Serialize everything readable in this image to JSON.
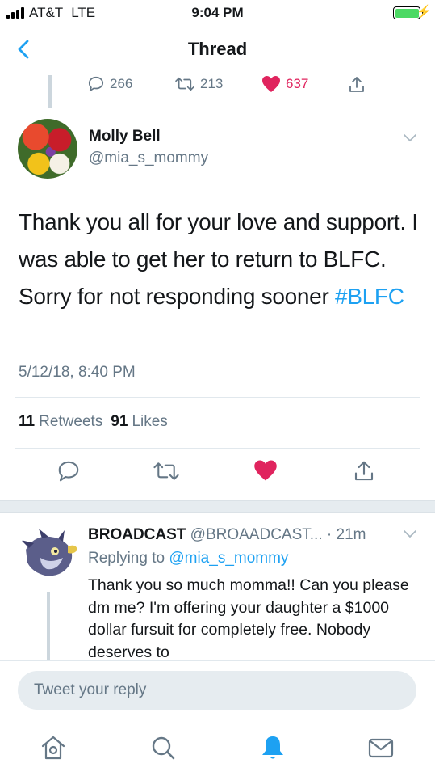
{
  "status_bar": {
    "carrier": "AT&T",
    "network": "LTE",
    "time": "9:04 PM",
    "battery_level": 1.0,
    "battery_color": "#4cd964"
  },
  "nav": {
    "title": "Thread",
    "back_icon": "chevron-left-icon"
  },
  "previous_tweet_actions": {
    "replies": "266",
    "retweets": "213",
    "likes": "637",
    "liked": true
  },
  "main_tweet": {
    "author_name": "Molly Bell",
    "author_handle": "@mia_s_mommy",
    "text": "Thank you all for your love and support. I was able to get her to return to BLFC. Sorry for not responding sooner ",
    "hashtag": "#BLFC",
    "timestamp": "5/12/18, 8:40 PM",
    "retweet_count": "11",
    "retweet_label": "Retweets",
    "like_count": "91",
    "like_label": "Likes",
    "liked": true
  },
  "reply_tweet": {
    "author_name": "BROADCAST",
    "author_handle": "@BROAADCAST...",
    "time_ago": "· 21m",
    "replying_to_label": "Replying to",
    "replying_to_handle": "@mia_s_mommy",
    "text": "Thank you so much momma!! Can you please dm me? I'm offering your daughter a $1000 dollar fursuit for completely free. Nobody deserves to"
  },
  "compose": {
    "placeholder": "Tweet your reply"
  },
  "tab_bar": {
    "items": [
      "home-icon",
      "search-icon",
      "notifications-icon",
      "messages-icon"
    ],
    "active": "notifications-icon"
  },
  "colors": {
    "accent": "#1da1f2",
    "like": "#e0245e",
    "secondary_text": "#657786",
    "divider": "#e1e8ed"
  }
}
